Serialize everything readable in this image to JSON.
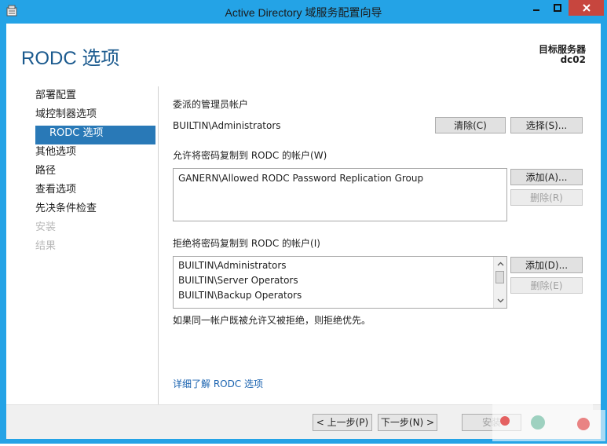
{
  "window": {
    "title": "Active Directory 域服务配置向导",
    "controls": {
      "minimize": "minimize-icon",
      "maximize": "maximize-icon",
      "close": "close-icon"
    }
  },
  "header": {
    "page_title": "RODC 选项",
    "target_label": "目标服务器",
    "target_name": "dc02"
  },
  "nav": {
    "items": [
      {
        "label": "部署配置",
        "state": "normal"
      },
      {
        "label": "域控制器选项",
        "state": "normal"
      },
      {
        "label": "RODC 选项",
        "state": "active"
      },
      {
        "label": "其他选项",
        "state": "normal"
      },
      {
        "label": "路径",
        "state": "normal"
      },
      {
        "label": "查看选项",
        "state": "normal"
      },
      {
        "label": "先决条件检查",
        "state": "normal"
      },
      {
        "label": "安装",
        "state": "disabled"
      },
      {
        "label": "结果",
        "state": "disabled"
      }
    ]
  },
  "delegated": {
    "heading": "委派的管理员帐户",
    "value": "BUILTIN\\Administrators",
    "clear_button": "清除(C)",
    "select_button": "选择(S)..."
  },
  "allowed": {
    "heading": "允许将密码复制到 RODC 的帐户(W)",
    "items": [
      "GANERN\\Allowed RODC Password Replication Group"
    ],
    "add_button": "添加(A)...",
    "remove_button": "删除(R)"
  },
  "denied": {
    "heading": "拒绝将密码复制到 RODC 的帐户(I)",
    "items": [
      "BUILTIN\\Administrators",
      "BUILTIN\\Server Operators",
      "BUILTIN\\Backup Operators"
    ],
    "add_button": "添加(D)...",
    "remove_button": "删除(E)"
  },
  "note": "如果同一帐户既被允许又被拒绝，则拒绝优先。",
  "learn_more": "详细了解 RODC 选项",
  "footer": {
    "prev_button": "< 上一步(P)",
    "next_button": "下一步(N) >",
    "install_button": "安装"
  },
  "colors": {
    "titlebar": "#24a3e6",
    "close": "#c7463e",
    "nav_active": "#2979b7",
    "page_title": "#1b5a8e",
    "link": "#1a63b0"
  }
}
